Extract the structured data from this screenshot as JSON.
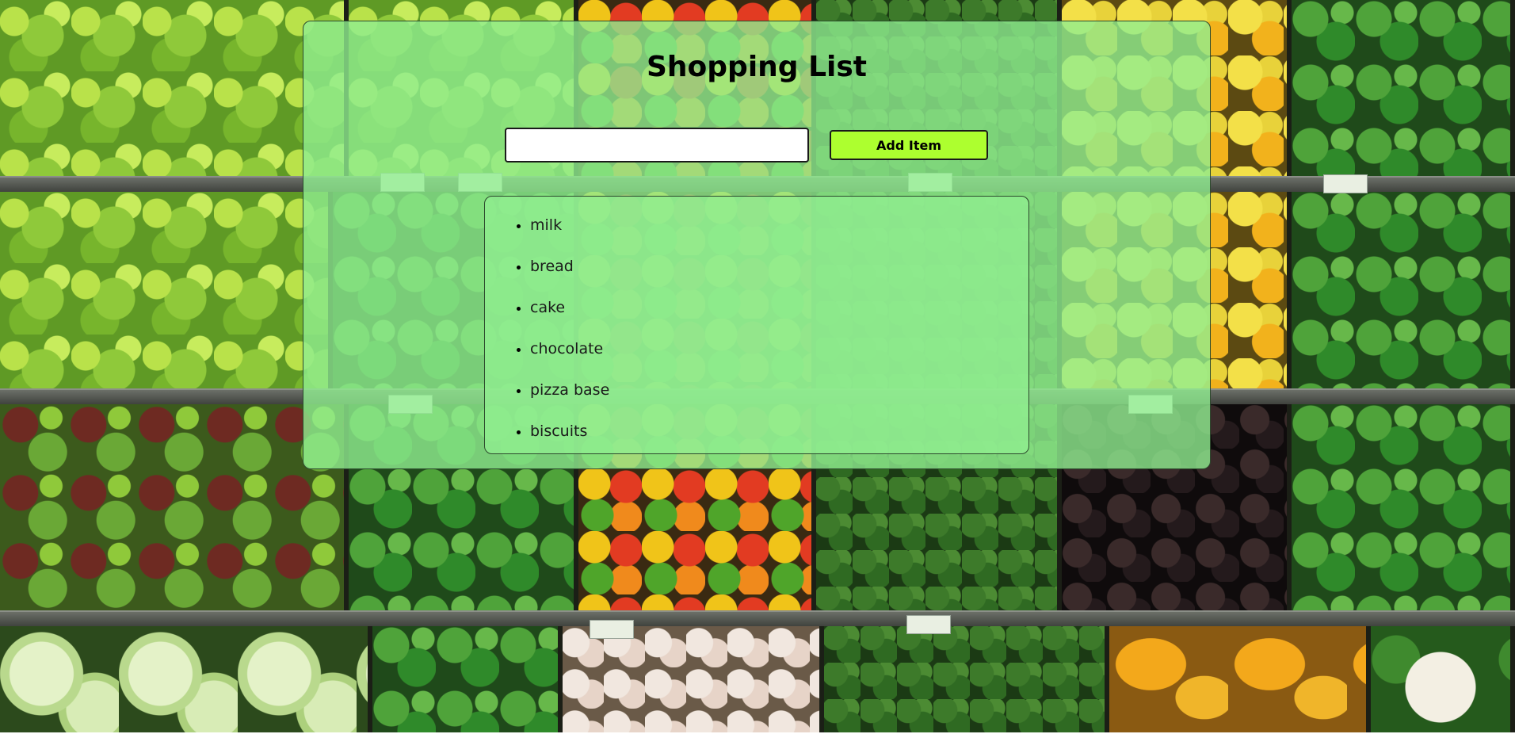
{
  "app": {
    "title": "Shopping List"
  },
  "form": {
    "input_value": "",
    "input_placeholder": "",
    "add_button_label": "Add Item"
  },
  "list": {
    "items": [
      {
        "label": "milk"
      },
      {
        "label": "bread"
      },
      {
        "label": "cake"
      },
      {
        "label": "chocolate"
      },
      {
        "label": "pizza base"
      },
      {
        "label": "biscuits"
      }
    ]
  },
  "colors": {
    "card_background": "#90ee90",
    "button_background": "#adff2f",
    "text": "#000000"
  }
}
